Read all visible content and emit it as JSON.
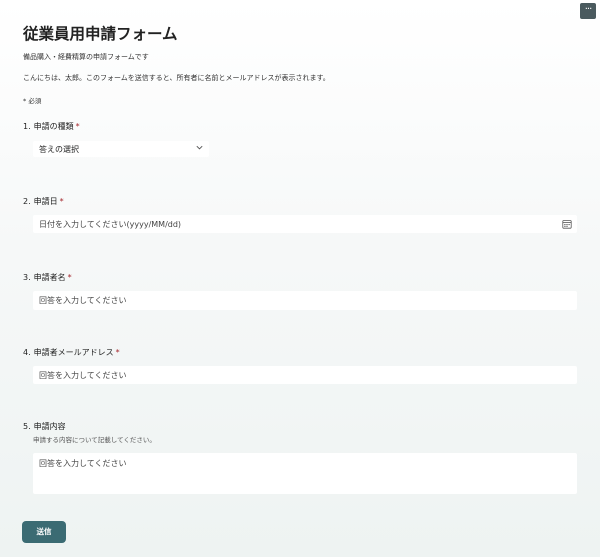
{
  "form": {
    "title": "従業員用申請フォーム",
    "description": "備品購入・経費精算の申請フォームです",
    "notice": "こんにちは、太郎。このフォームを送信すると、所有者に名前とメールアドレスが表示されます。",
    "required_note": "* 必須",
    "required_mark": "*"
  },
  "questions": [
    {
      "number": "1.",
      "label": "申請の種類",
      "required": true,
      "value": "答えの選択",
      "icon": "chevron-down-icon"
    },
    {
      "number": "2.",
      "label": "申請日",
      "required": true,
      "placeholder": "日付を入力してください(yyyy/MM/dd)",
      "icon": "calendar-icon"
    },
    {
      "number": "3.",
      "label": "申請者名",
      "required": true,
      "placeholder": "回答を入力してください"
    },
    {
      "number": "4.",
      "label": "申請者メールアドレス",
      "required": true,
      "placeholder": "回答を入力してください"
    },
    {
      "number": "5.",
      "label": "申請内容",
      "required": false,
      "subtitle": "申請する内容について記載してください。",
      "placeholder": "回答を入力してください"
    }
  ],
  "submit_label": "送信",
  "more_icon": "more-horizontal-icon",
  "colors": {
    "accent": "#3b6b73",
    "required": "#a4262c",
    "more_button": "#4a5a5e"
  }
}
